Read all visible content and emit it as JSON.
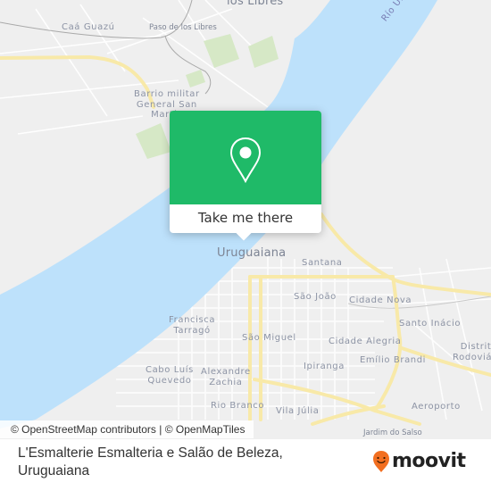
{
  "map": {
    "labels": {
      "los_libres": "los Libres",
      "caa_guazu": "Caá Guazú",
      "paso_de_los_libres": "Paso de los Libres",
      "barrio_militar": "Barrio militar\nGeneral San\nMartín",
      "rio_uruguay": "Río Uruguay",
      "uruguaiana": "Uruguaiana",
      "santana": "Santana",
      "sao_joao": "São João",
      "cidade_nova": "Cidade Nova",
      "santo_inacio": "Santo Inácio",
      "francisca_tarrago": "Francisca\nTarragó",
      "sao_miguel": "São Miguel",
      "cidade_alegria": "Cidade Alegria",
      "distrito_rodoviario": "Distrito\nRodoviário",
      "cabo_luis_quevedo": "Cabo Luís\nQuevedo",
      "alexandre_zachia": "Alexandre\nZachia",
      "ipiranga": "Ipiranga",
      "emilio_brandi": "Emílio Brandi",
      "rio_branco": "Rio Branco",
      "vila_julia": "Vila Júlia",
      "aeroporto": "Aeroporto",
      "jardim_do_salso": "Jardim do Salso"
    },
    "colors": {
      "land": "#efefef",
      "water": "#bde1fb",
      "road_major": "#f8e9a8",
      "road_minor": "#ffffff",
      "park": "#d6e8c6"
    }
  },
  "popup": {
    "icon": "map-pin-icon",
    "button_label": "Take me there",
    "color": "#1fba68"
  },
  "attribution": "© OpenStreetMap contributors | © OpenMapTiles",
  "footer": {
    "place_title": "L'Esmalterie Esmalteria e Salão de Beleza, Uruguaiana",
    "logo_text": "moovit",
    "logo_icon": "moovit-smile-pin-icon",
    "logo_color": "#f26f21"
  }
}
